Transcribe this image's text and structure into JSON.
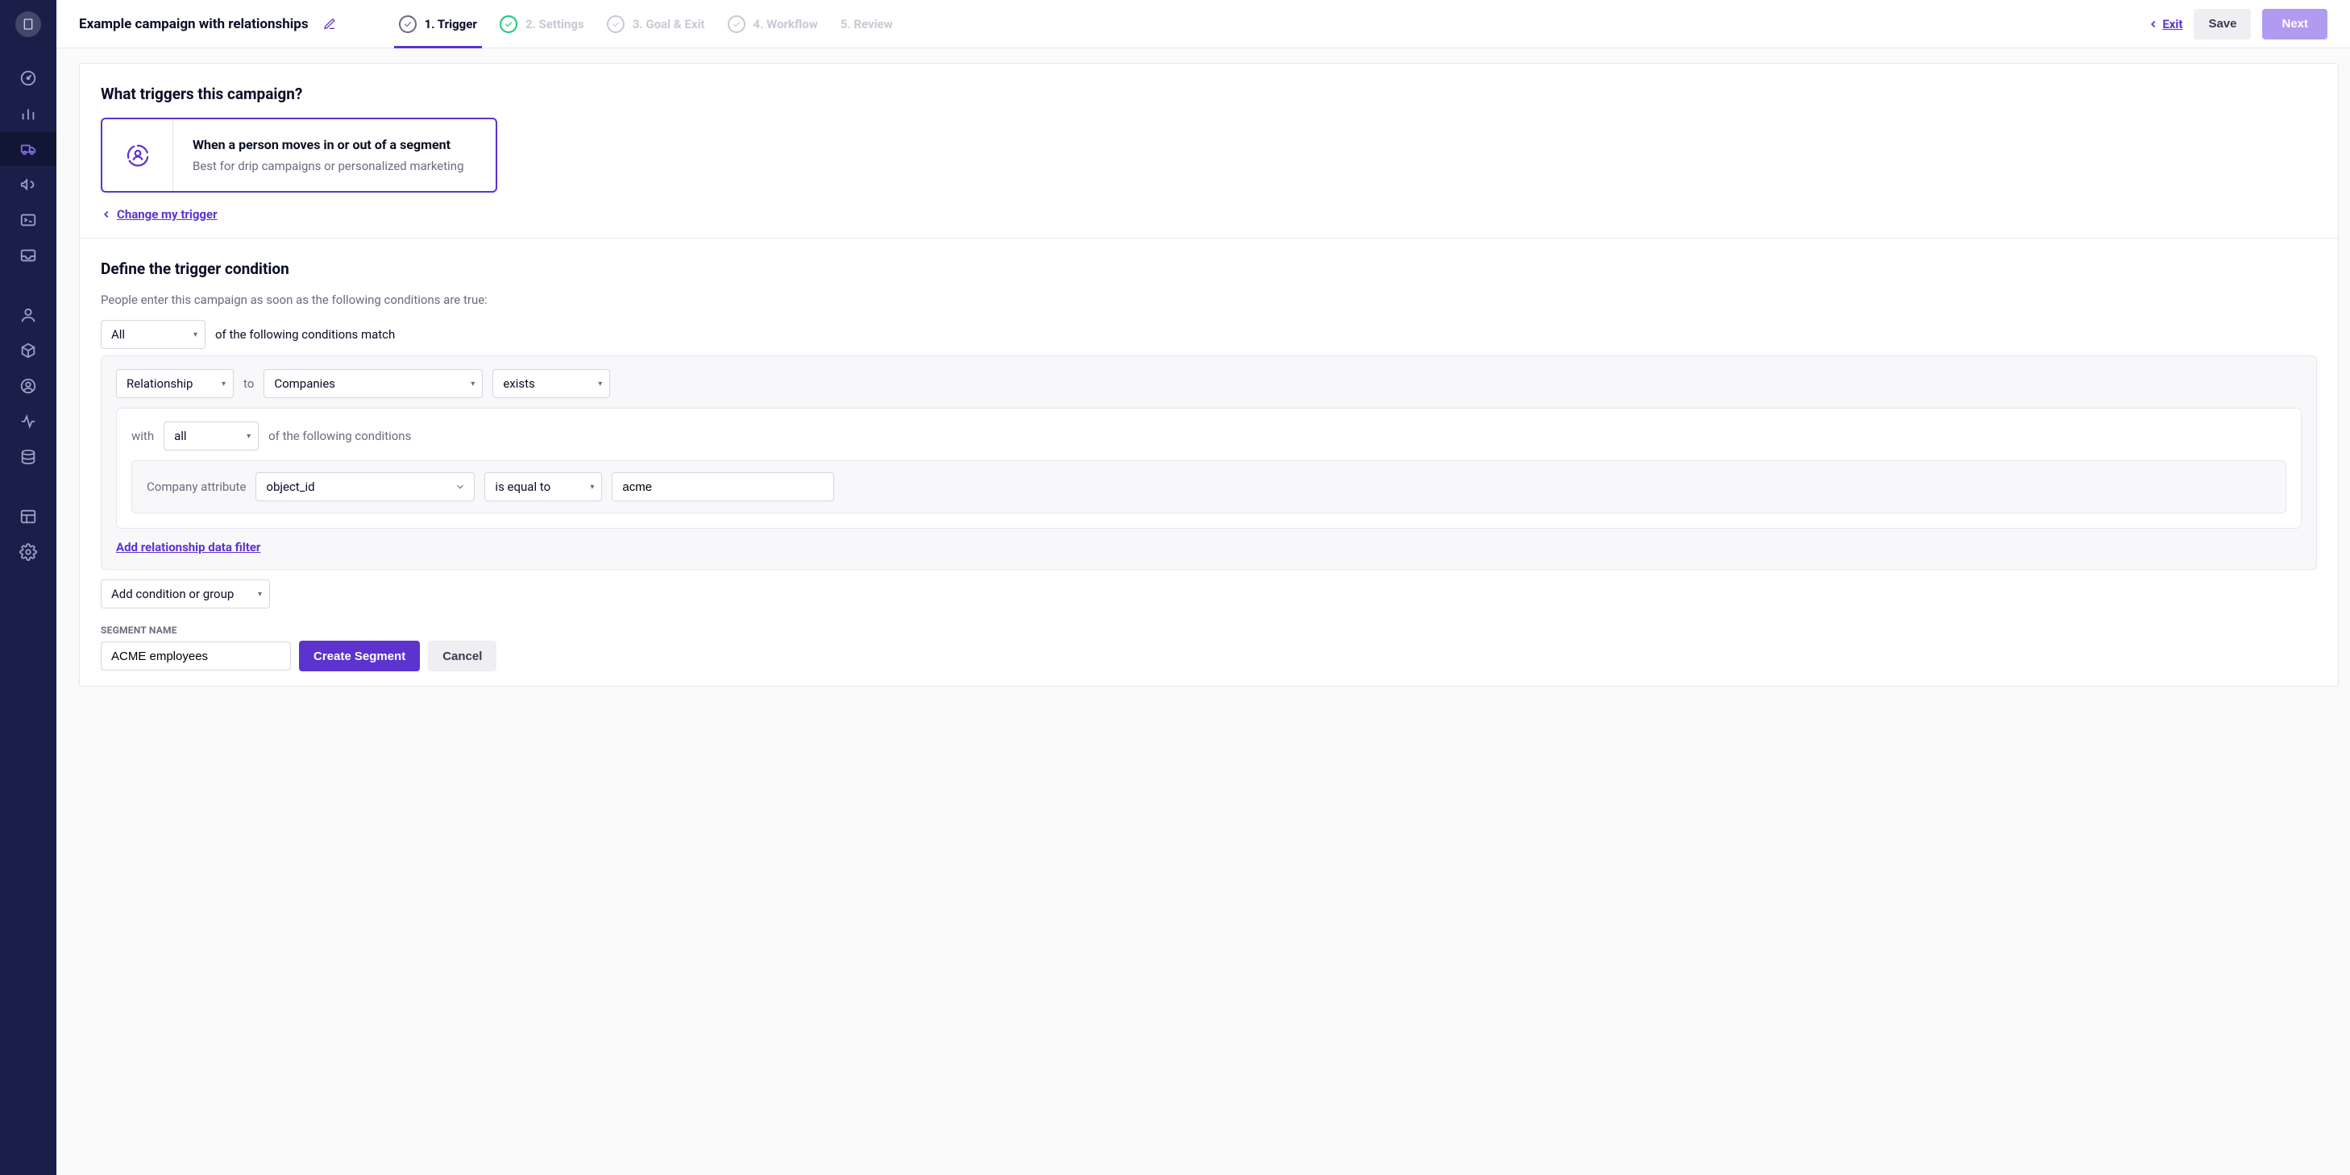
{
  "header": {
    "title": "Example campaign with relationships",
    "steps": [
      "1. Trigger",
      "2. Settings",
      "3. Goal & Exit",
      "4. Workflow",
      "5. Review"
    ],
    "exit": "Exit",
    "save": "Save",
    "next": "Next"
  },
  "trigger_section": {
    "heading": "What triggers this campaign?",
    "card_title": "When a person moves in or out of a segment",
    "card_desc": "Best for drip campaigns or personalized marketing",
    "change_link": "Change my trigger"
  },
  "condition_section": {
    "heading": "Define the trigger condition",
    "desc": "People enter this campaign as soon as the following conditions are true:",
    "match_select": "All",
    "match_suffix": "of the following conditions match",
    "cond1_type": "Relationship",
    "cond1_to_label": "to",
    "cond1_object": "Companies",
    "cond1_exists": "exists",
    "with_label": "with",
    "with_select": "all",
    "with_suffix": "of the following conditions",
    "attr_label": "Company attribute",
    "attr_field": "object_id",
    "attr_op": "is equal to",
    "attr_value": "acme",
    "add_filter": "Add relationship data filter",
    "add_condition": "Add condition or group",
    "segment_name_label": "SEGMENT NAME",
    "segment_name_value": "ACME employees",
    "create_btn": "Create Segment",
    "cancel_btn": "Cancel"
  }
}
